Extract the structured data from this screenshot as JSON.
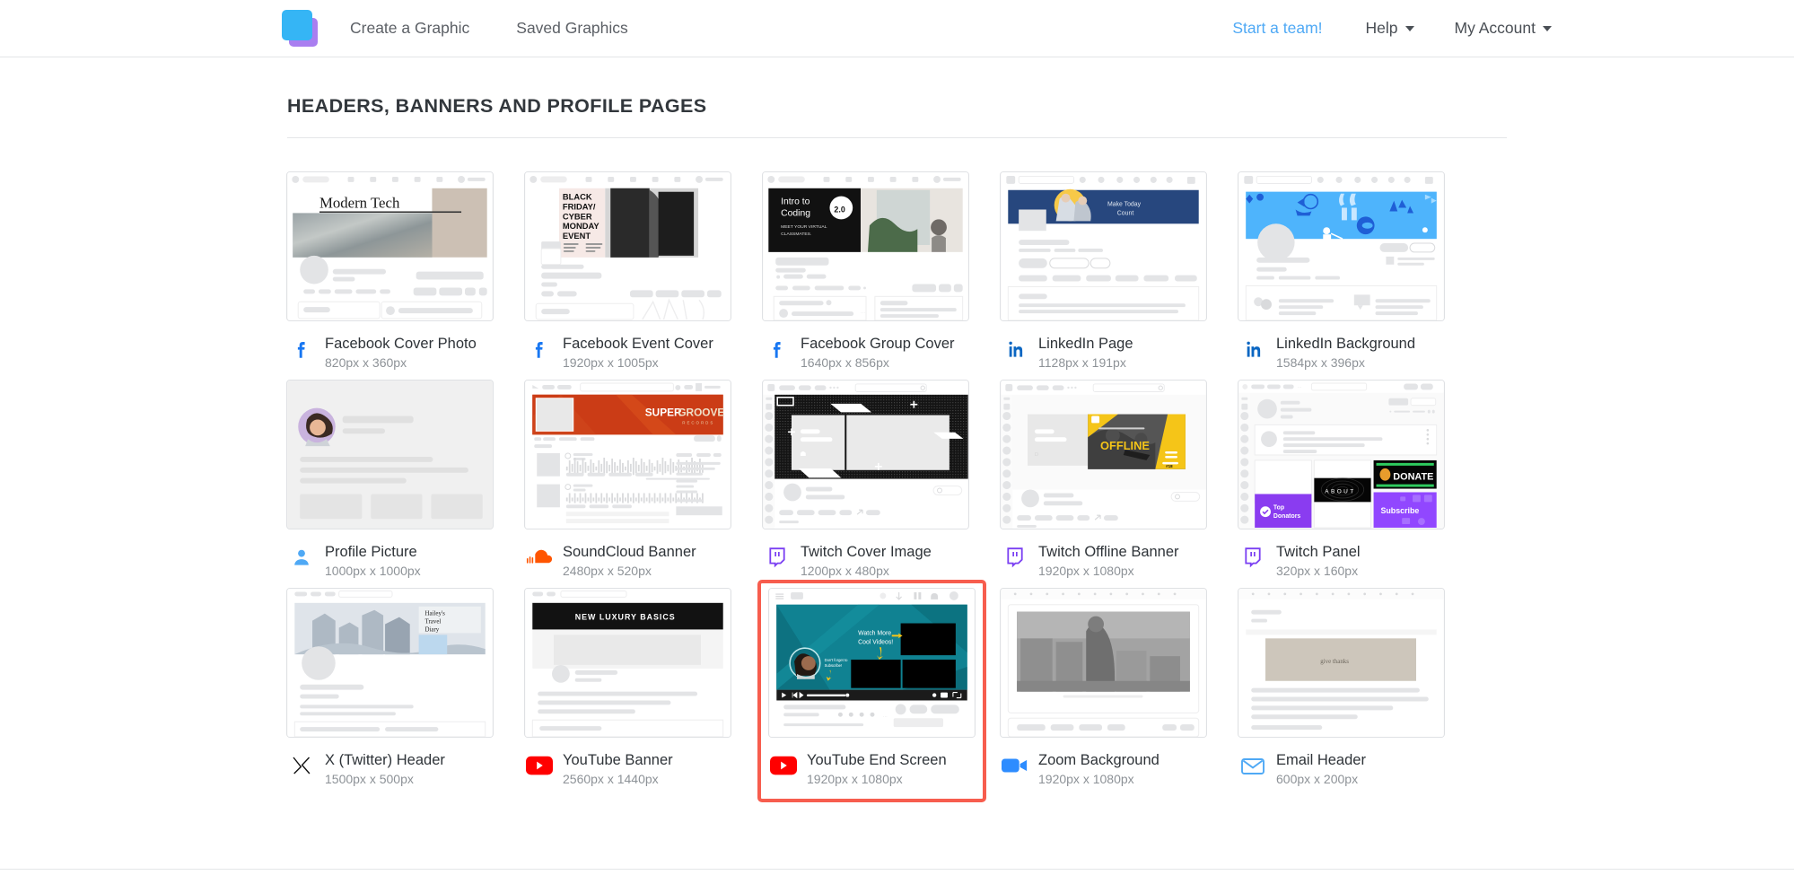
{
  "nav": {
    "logo_icon": "stacked-squares-logo",
    "links": [
      {
        "label": "Create a Graphic"
      },
      {
        "label": "Saved Graphics"
      }
    ],
    "start_team": "Start a team!",
    "help": "Help",
    "account": "My Account"
  },
  "page": {
    "section_title": "HEADERS, BANNERS AND PROFILE PAGES"
  },
  "colors": {
    "accent_blue": "#4fa9f5",
    "selection_red": "#f75d4e",
    "facebook": "#1877f2",
    "linkedin": "#0a66c2",
    "twitch": "#7a3ff2",
    "soundcloud": "#ff5500",
    "youtube": "#ff0000",
    "zoom": "#2d8cff",
    "email": "#4fa9f5"
  },
  "cards": [
    {
      "id": "facebook-cover-photo",
      "title": "Facebook Cover Photo",
      "dimensions": "820px x 360px",
      "icon": "facebook-icon",
      "thumb_text": "Modern Tech",
      "selected": false
    },
    {
      "id": "facebook-event-cover",
      "title": "Facebook Event Cover",
      "dimensions": "1920px x 1005px",
      "icon": "facebook-icon",
      "thumb_text": "BLACK FRIDAY / CYBER MONDAY EVENT",
      "selected": false
    },
    {
      "id": "facebook-group-cover",
      "title": "Facebook Group Cover",
      "dimensions": "1640px x 856px",
      "icon": "facebook-icon",
      "thumb_text": "Intro to Coding 2.0 — MEET YOUR VIRTUAL CLASSMATES",
      "selected": false
    },
    {
      "id": "linkedin-page",
      "title": "LinkedIn Page",
      "dimensions": "1128px x 191px",
      "icon": "linkedin-icon",
      "thumb_text": "Make Today Count",
      "selected": false
    },
    {
      "id": "linkedin-background",
      "title": "LinkedIn Background",
      "dimensions": "1584px x 396px",
      "icon": "linkedin-icon",
      "thumb_text": "",
      "selected": false
    },
    {
      "id": "profile-picture",
      "title": "Profile Picture",
      "dimensions": "1000px x 1000px",
      "icon": "person-icon",
      "thumb_text": "",
      "selected": false
    },
    {
      "id": "soundcloud-banner",
      "title": "SoundCloud Banner",
      "dimensions": "2480px x 520px",
      "icon": "soundcloud-icon",
      "thumb_text": "SUPER GROOVE RECORDS",
      "selected": false
    },
    {
      "id": "twitch-cover-image",
      "title": "Twitch Cover Image",
      "dimensions": "1200px x 480px",
      "icon": "twitch-icon",
      "thumb_text": "",
      "selected": false
    },
    {
      "id": "twitch-offline-banner",
      "title": "Twitch Offline Banner",
      "dimensions": "1920px x 1080px",
      "icon": "twitch-icon",
      "thumb_text": "OFFLINE",
      "selected": false
    },
    {
      "id": "twitch-panel",
      "title": "Twitch Panel",
      "dimensions": "320px x 160px",
      "icon": "twitch-icon",
      "thumb_text": "Top Donators / ABOUT / DONATE / Subscribe",
      "selected": false
    },
    {
      "id": "x-twitter-header",
      "title": "X (Twitter) Header",
      "dimensions": "1500px x 500px",
      "icon": "x-twitter-icon",
      "thumb_text": "Hailey's Travel Diary",
      "selected": false
    },
    {
      "id": "youtube-banner",
      "title": "YouTube Banner",
      "dimensions": "2560px x 1440px",
      "icon": "youtube-icon",
      "thumb_text": "NEW LUXURY BASICS",
      "selected": false
    },
    {
      "id": "youtube-end-screen",
      "title": "YouTube End Screen",
      "dimensions": "1920px x 1080px",
      "icon": "youtube-icon",
      "thumb_text": "Watch More Cool Videos!",
      "selected": true
    },
    {
      "id": "zoom-background",
      "title": "Zoom Background",
      "dimensions": "1920px x 1080px",
      "icon": "zoom-icon",
      "thumb_text": "",
      "selected": false
    },
    {
      "id": "email-header",
      "title": "Email Header",
      "dimensions": "600px x 200px",
      "icon": "email-icon",
      "thumb_text": "give thanks",
      "selected": false
    }
  ]
}
